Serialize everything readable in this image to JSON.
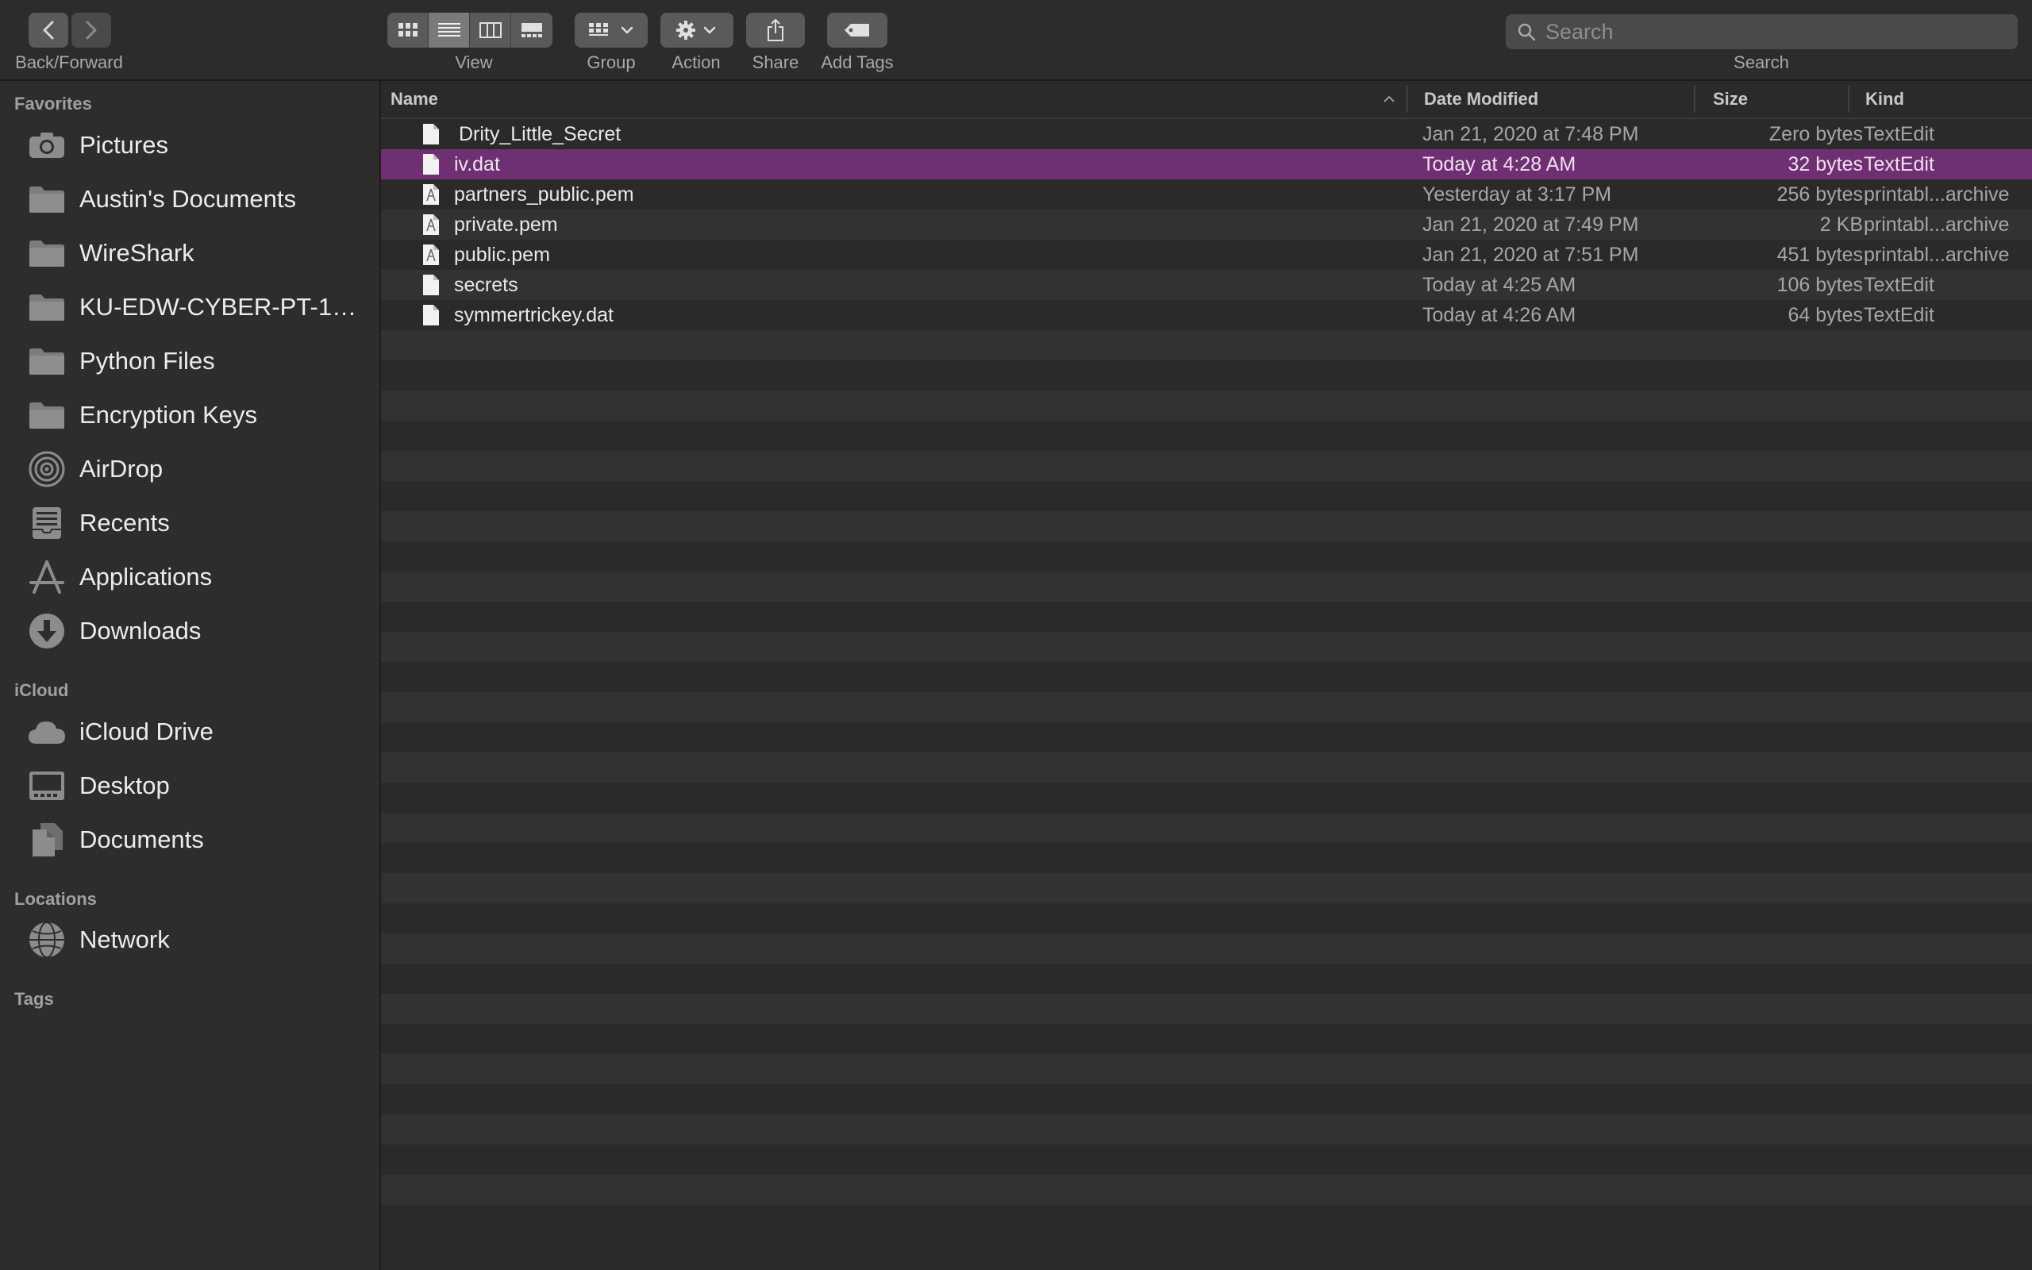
{
  "toolbar": {
    "back_forward_label": "Back/Forward",
    "view_label": "View",
    "group_label": "Group",
    "action_label": "Action",
    "share_label": "Share",
    "add_tags_label": "Add Tags",
    "search_label": "Search",
    "search_placeholder": "Search"
  },
  "sidebar": {
    "favorites_title": "Favorites",
    "favorites": [
      {
        "label": "Pictures",
        "icon": "camera-icon"
      },
      {
        "label": "Austin's Documents",
        "icon": "folder-icon"
      },
      {
        "label": "WireShark",
        "icon": "folder-icon"
      },
      {
        "label": "KU-EDW-CYBER-PT-10...",
        "icon": "folder-icon"
      },
      {
        "label": "Python Files",
        "icon": "folder-icon"
      },
      {
        "label": "Encryption Keys",
        "icon": "folder-icon"
      },
      {
        "label": "AirDrop",
        "icon": "airdrop-icon"
      },
      {
        "label": "Recents",
        "icon": "recents-icon"
      },
      {
        "label": "Applications",
        "icon": "applications-icon"
      },
      {
        "label": "Downloads",
        "icon": "downloads-icon"
      }
    ],
    "icloud_title": "iCloud",
    "icloud": [
      {
        "label": "iCloud Drive",
        "icon": "cloud-icon"
      },
      {
        "label": "Desktop",
        "icon": "desktop-icon"
      },
      {
        "label": "Documents",
        "icon": "documents-icon"
      }
    ],
    "locations_title": "Locations",
    "locations": [
      {
        "label": "Network",
        "icon": "globe-icon"
      }
    ],
    "tags_title": "Tags"
  },
  "list": {
    "columns": {
      "name": "Name",
      "date": "Date Modified",
      "size": "Size",
      "kind": "Kind"
    },
    "files": [
      {
        "name": "Drity_Little_Secret",
        "date": "Jan 21, 2020 at 7:48 PM",
        "size": "Zero bytes",
        "kind": "TextEdit",
        "icon": "text-file-icon"
      },
      {
        "name": "iv.dat",
        "date": "Today at 4:28 AM",
        "size": "32 bytes",
        "kind": "TextEdit",
        "icon": "text-file-icon",
        "selected": true
      },
      {
        "name": "partners_public.pem",
        "date": "Yesterday at 3:17 PM",
        "size": "256 bytes",
        "kind": "printabl...archive",
        "icon": "pem-file-icon"
      },
      {
        "name": "private.pem",
        "date": "Jan 21, 2020 at 7:49 PM",
        "size": "2 KB",
        "kind": "printabl...archive",
        "icon": "pem-file-icon"
      },
      {
        "name": "public.pem",
        "date": "Jan 21, 2020 at 7:51 PM",
        "size": "451 bytes",
        "kind": "printabl...archive",
        "icon": "pem-file-icon"
      },
      {
        "name": "secrets",
        "date": "Today at 4:25 AM",
        "size": "106 bytes",
        "kind": "TextEdit",
        "icon": "text-file-icon"
      },
      {
        "name": "symmertrickey.dat",
        "date": "Today at 4:26 AM",
        "size": "64 bytes",
        "kind": "TextEdit",
        "icon": "text-file-icon"
      }
    ]
  },
  "colors": {
    "selection": "#6f2f73",
    "background": "#2a2a2a",
    "stripe": "#323232"
  }
}
